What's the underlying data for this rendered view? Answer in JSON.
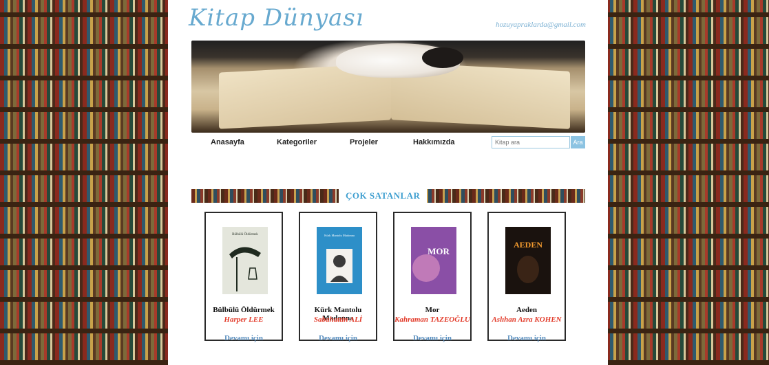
{
  "header": {
    "logo": "Kitap Dünyası",
    "email": "hozuyapraklarda@gmail.com"
  },
  "nav": {
    "items": [
      "Anasayfa",
      "Kategoriler",
      "Projeler",
      "Hakkımızda"
    ],
    "search_placeholder": "Kitap ara",
    "search_button": "Ara"
  },
  "section": {
    "title": "ÇOK SATANLAR"
  },
  "books": [
    {
      "title": "Bülbülü Öldürmek",
      "author": "Harper LEE",
      "link": "Devamı için"
    },
    {
      "title": "Kürk Mantolu Madonna",
      "author": "Sabahattin ALİ",
      "link": "Devamı için"
    },
    {
      "title": "Mor",
      "author": "Kahraman TAZEOĞLU",
      "link": "Devamı için"
    },
    {
      "title": "Aeden",
      "author": "Aslıhan Azra KOHEN",
      "link": "Devamı için"
    }
  ],
  "covers": [
    {
      "bg": "#e4e6dc",
      "accent": "#1f2a1f",
      "text": "Bülbülü Öldürmek"
    },
    {
      "bg": "#2d8fc8",
      "accent": "#ffffff",
      "text": "Kürk Mantolu Madonna"
    },
    {
      "bg": "#8a4fa6",
      "accent": "#ffffff",
      "text": "MOR"
    },
    {
      "bg": "#1a120e",
      "accent": "#f29a2e",
      "text": "AEDEN"
    }
  ]
}
